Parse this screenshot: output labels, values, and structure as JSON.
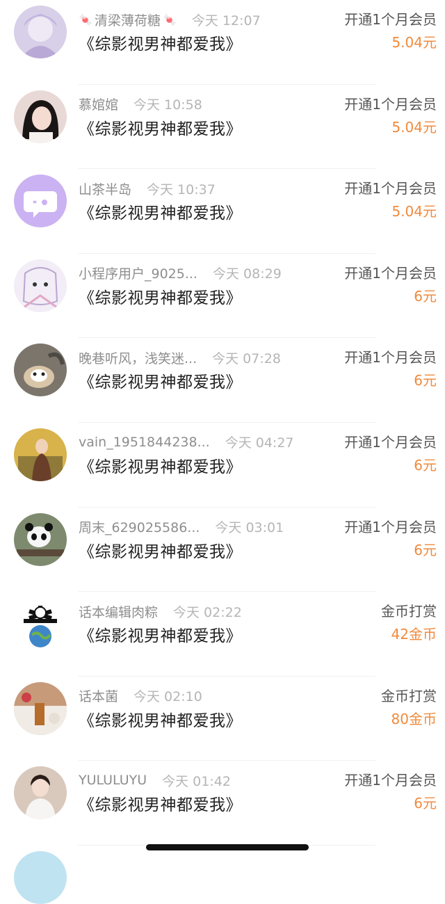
{
  "items": [
    {
      "username": "清梁薄荷糖",
      "decorated": true,
      "time": "今天 12:07",
      "title": "《综影视男神都爱我》",
      "action": "开通1个月会员",
      "amount": "5.04元",
      "avatar_color": "#d8cfe8",
      "avatar_icon": "avatar-purple-girl"
    },
    {
      "username": "慕婠婠",
      "decorated": false,
      "time": "今天 10:58",
      "title": "《综影视男神都爱我》",
      "action": "开通1个月会员",
      "amount": "5.04元",
      "avatar_color": "#e9d9d6",
      "avatar_icon": "avatar-dark-hair-girl"
    },
    {
      "username": "山茶半岛",
      "decorated": false,
      "time": "今天 10:37",
      "title": "《综影视男神都爱我》",
      "action": "开通1个月会员",
      "amount": "5.04元",
      "avatar_color": "#cbb2f2",
      "avatar_icon": "chat-bubble-icon"
    },
    {
      "username": "小程序用户_9025...",
      "decorated": false,
      "time": "今天 08:29",
      "title": "《综影视男神都爱我》",
      "action": "开通1个月会员",
      "amount": "6元",
      "avatar_color": "#f2edf6",
      "avatar_icon": "avatar-sketch-girl"
    },
    {
      "username": "晚巷听风，浅笑迷...",
      "decorated": false,
      "time": "今天 07:28",
      "title": "《综影视男神都爱我》",
      "action": "开通1个月会员",
      "amount": "6元",
      "avatar_color": "#7c756c",
      "avatar_icon": "avatar-dog"
    },
    {
      "username": "vain_1951844238...",
      "decorated": false,
      "time": "今天 04:27",
      "title": "《综影视男神都爱我》",
      "action": "开通1个月会员",
      "amount": "6元",
      "avatar_color": "#d8b24a",
      "avatar_icon": "avatar-painting"
    },
    {
      "username": "周末_629025586...",
      "decorated": false,
      "time": "今天 03:01",
      "title": "《综影视男神都爱我》",
      "action": "开通1个月会员",
      "amount": "6元",
      "avatar_color": "#7e8a6e",
      "avatar_icon": "avatar-panda"
    },
    {
      "username": "话本编辑肉粽",
      "decorated": false,
      "time": "今天 02:22",
      "title": "《综影视男神都爱我》",
      "action": "金币打赏",
      "amount": "42金币",
      "avatar_color": "#ffffff",
      "avatar_icon": "avatar-earth-skull"
    },
    {
      "username": "话本菌",
      "decorated": false,
      "time": "今天 02:10",
      "title": "《综影视男神都爱我》",
      "action": "金币打赏",
      "amount": "80金币",
      "avatar_color": "#c79a7a",
      "avatar_icon": "avatar-food-table"
    },
    {
      "username": "YULULUYU",
      "decorated": false,
      "time": "今天 01:42",
      "title": "《综影视男神都爱我》",
      "action": "开通1个月会员",
      "amount": "6元",
      "avatar_color": "#d9c8bc",
      "avatar_icon": "avatar-girl-white-dress"
    }
  ]
}
